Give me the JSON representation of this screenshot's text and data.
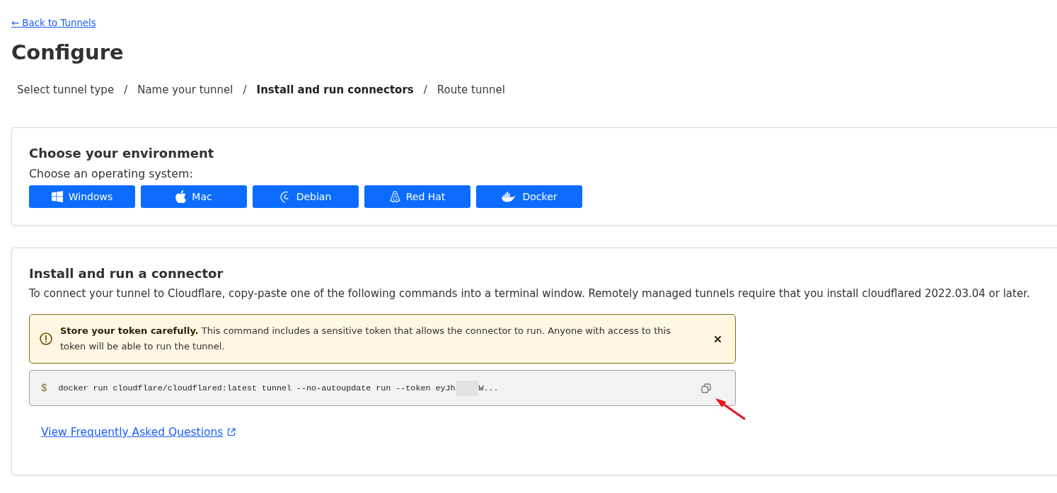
{
  "back_link": {
    "label": "← Back to Tunnels"
  },
  "title": "Configure",
  "steps": [
    {
      "label": "Select tunnel type",
      "selected": false,
      "separator": "/"
    },
    {
      "label": "Name your tunnel",
      "selected": false,
      "separator": "/"
    },
    {
      "label": "Install and run connectors",
      "selected": true,
      "separator": "/"
    },
    {
      "label": "Route tunnel",
      "selected": false
    }
  ],
  "environment_card": {
    "title": "Choose your environment",
    "prompt": "Choose an operating system:",
    "os_buttons": [
      {
        "label": "Windows",
        "kind": "windows"
      },
      {
        "label": "Mac",
        "kind": "apple"
      },
      {
        "label": "Debian",
        "kind": "debian"
      },
      {
        "label": "Red Hat",
        "kind": "linux"
      },
      {
        "label": "Docker",
        "kind": "docker"
      }
    ]
  },
  "connector_card": {
    "title": "Install and run a connector",
    "description": "To connect your tunnel to Cloudflare, copy-paste one of the following commands into a terminal window. Remotely managed tunnels require that you install cloudflared 2022.03.04 or later.",
    "alert": {
      "text": "**Store your token carefully.** This command includes a sensitive token that allows the connector to run. Anyone with access to this token will be able to run the tunnel.",
      "dismissible": true
    },
    "command": {
      "prompt": "$",
      "text_start": "docker run cloudflare/cloudflared:latest tunnel --no-autoupdate run --token eyJh",
      "redacted": true,
      "text_end": "W..."
    },
    "faq_link": {
      "label": "View Frequently Asked Questions"
    }
  },
  "annotations": [
    {
      "kind": "arrow"
    }
  ]
}
